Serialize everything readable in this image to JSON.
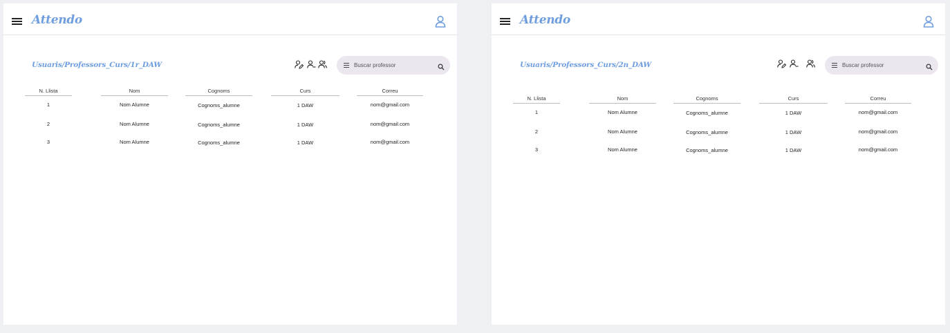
{
  "colors": {
    "accent": "#6f9edf",
    "search_bg": "#ece6ef",
    "page_bg": "#eef0f3"
  },
  "screens": [
    {
      "app_title": "Attendo",
      "breadcrumb": "Usuaris/Professors_Curs/1r_DAW",
      "search_placeholder": "Buscar professor",
      "icons": [
        "menu-icon",
        "user-icon",
        "user-edit-icon",
        "user-remove-icon",
        "user-group-icon",
        "search-icon"
      ],
      "table": {
        "headers": [
          "N. Llista",
          "Nom",
          "Cognoms",
          "Curs",
          "Correu"
        ],
        "rows": [
          [
            "1",
            "Nom Alumne",
            "Cognoms_alumne",
            "1 DAW",
            "nom@gmail.com"
          ],
          [
            "2",
            "Nom Alumne",
            "Cognoms_alumne",
            "1 DAW",
            "nom@gmail.com"
          ],
          [
            "3",
            "Nom Alumne",
            "Cognoms_alumne",
            "1 DAW",
            "nom@gmail.com"
          ]
        ]
      }
    },
    {
      "app_title": "Attendo",
      "breadcrumb": "Usuaris/Professors_Curs/2n_DAW",
      "search_placeholder": "Buscar professor",
      "icons": [
        "menu-icon",
        "user-icon",
        "user-edit-icon",
        "user-remove-icon",
        "user-group-icon",
        "search-icon"
      ],
      "table": {
        "headers": [
          "N. Llista",
          "Nom",
          "Cognoms",
          "Curs",
          "Correu"
        ],
        "rows": [
          [
            "1",
            "Nom Alumne",
            "Cognoms_alumne",
            "1 DAW",
            "nom@gmail.com"
          ],
          [
            "2",
            "Nom Alumne",
            "Cognoms_alumne",
            "1 DAW",
            "nom@gmail.com"
          ],
          [
            "3",
            "Nom Alumne",
            "Cognoms_alumne",
            "1 DAW",
            "nom@gmail.com"
          ]
        ]
      }
    }
  ]
}
